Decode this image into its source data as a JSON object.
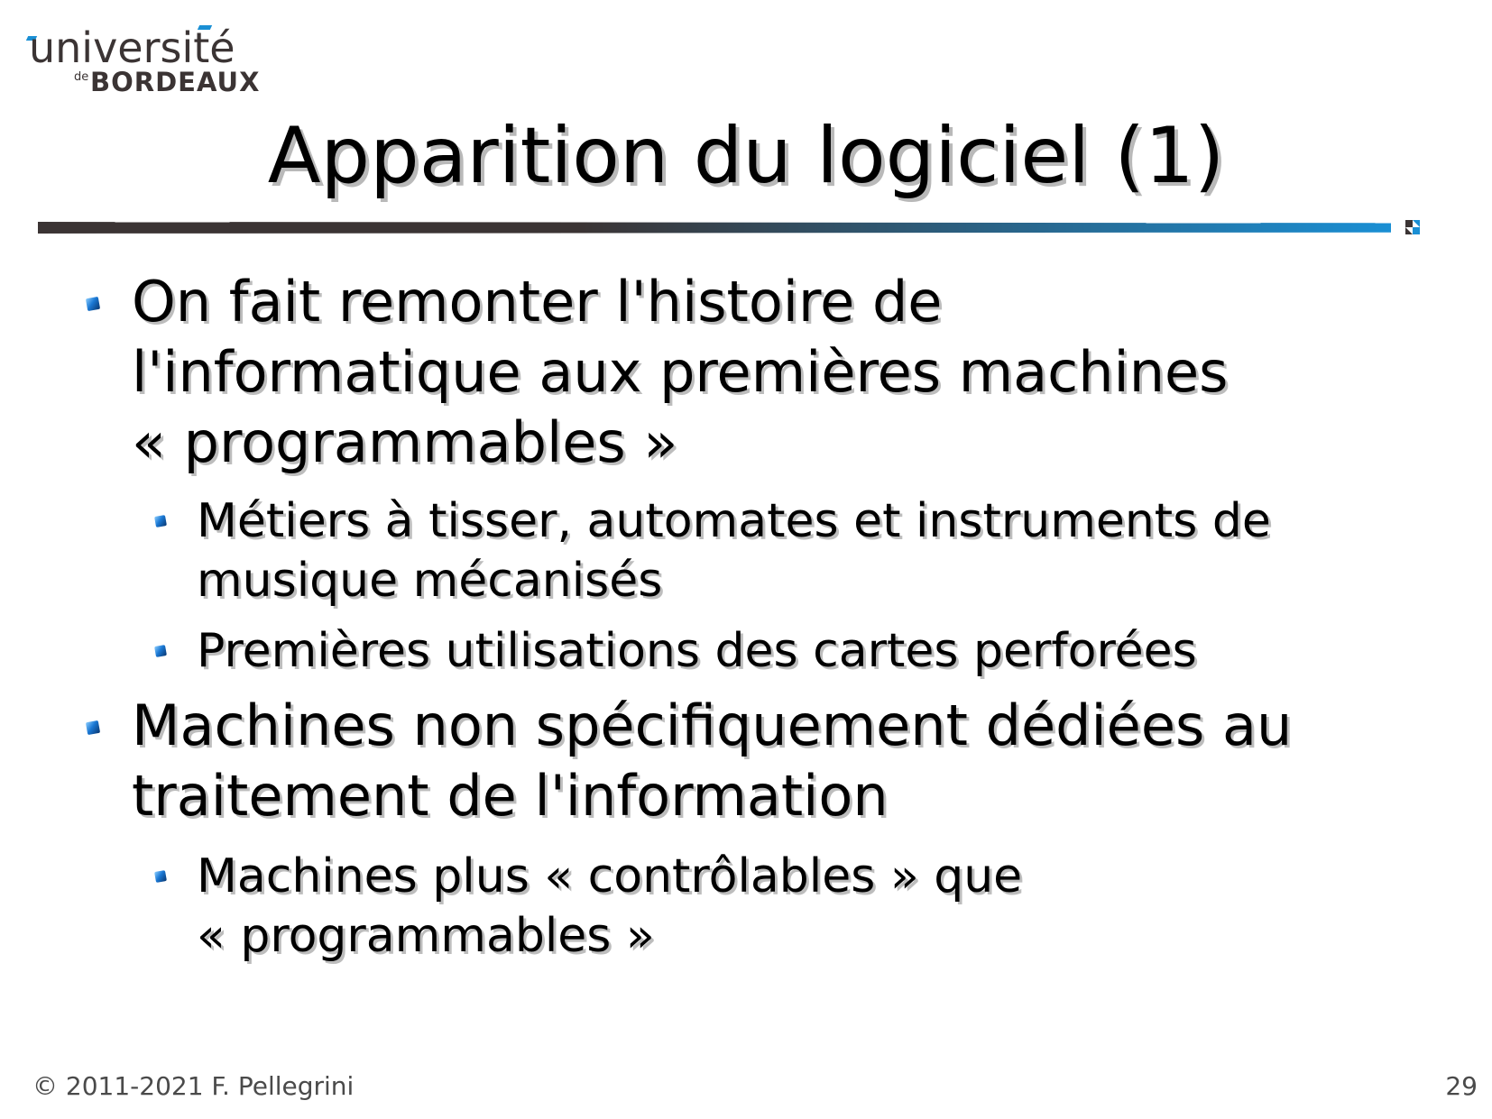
{
  "logo": {
    "top": "université",
    "de": "de",
    "bottom": "BORDEAUX"
  },
  "title": "Apparition du logiciel (1)",
  "bullets": [
    {
      "lines": [
        "On fait remonter l'histoire de",
        "l'informatique aux premières machines",
        "« programmables »"
      ],
      "children": [
        {
          "lines": [
            "Métiers à tisser, automates et instruments de",
            "musique mécanisés"
          ]
        },
        {
          "lines": [
            "Premières utilisations des cartes perforées"
          ]
        }
      ]
    },
    {
      "lines": [
        "Machines non spécifiquement dédiées au",
        "traitement de l'information"
      ],
      "children": [
        {
          "lines": [
            "Machines plus « contrôlables » que",
            "« programmables »"
          ]
        }
      ]
    }
  ],
  "footer": {
    "copyright": "© 2011-2021 F. Pellegrini",
    "page_number": "29"
  },
  "colors": {
    "brand_dark": "#3b3434",
    "brand_blue": "#1a8fd4"
  }
}
